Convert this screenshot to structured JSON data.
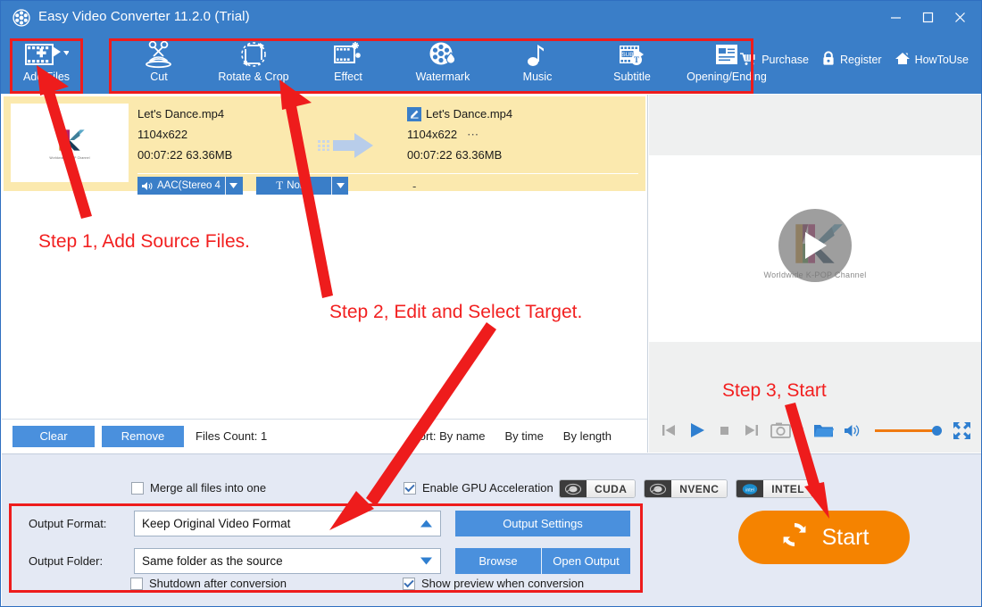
{
  "window": {
    "title": "Easy Video Converter 11.2.0 (Trial)",
    "app_icon": "film-reel-icon",
    "controls": {
      "minimize": "minimize-icon",
      "maximize": "maximize-icon",
      "close": "close-icon"
    }
  },
  "toolbar": {
    "add_files": {
      "label": "Add Files",
      "icon": "add-film-icon"
    },
    "items": [
      {
        "label": "Cut",
        "icon": "scissors-icon"
      },
      {
        "label": "Rotate & Crop",
        "icon": "rotate-crop-icon"
      },
      {
        "label": "Effect",
        "icon": "effect-film-icon"
      },
      {
        "label": "Watermark",
        "icon": "watermark-icon"
      },
      {
        "label": "Music",
        "icon": "music-note-icon"
      },
      {
        "label": "Subtitle",
        "icon": "subtitle-icon"
      },
      {
        "label": "Opening/Ending",
        "icon": "opening-ending-icon"
      }
    ],
    "links": [
      {
        "label": "Purchase",
        "icon": "cart-icon"
      },
      {
        "label": "Register",
        "icon": "lock-icon"
      },
      {
        "label": "HowToUse",
        "icon": "home-icon"
      }
    ]
  },
  "file_list": {
    "row": {
      "thumbnail_caption": "Worldwide K-POP Channel",
      "source": {
        "name": "Let's Dance.mp4",
        "resolution": "1104x622",
        "duration_size": "00:07:22  63.36MB"
      },
      "target": {
        "name": "Let's Dance.mp4",
        "resolution": "1104x622",
        "resolution_more": "⋯",
        "duration_size": "00:07:22  63.36MB",
        "edit_icon": "pencil-icon"
      },
      "audio_track": "AAC(Stereo 4",
      "subtitle_track": "None",
      "target_extra": "-"
    },
    "toolbar": {
      "clear": "Clear",
      "remove": "Remove",
      "files_count_label": "Files Count:",
      "files_count_value": "1",
      "sort_label": "Sort:",
      "sort_options": [
        "By name",
        "By time",
        "By length"
      ]
    }
  },
  "preview": {
    "caption": "Worldwide K-POP Channel",
    "controls": [
      {
        "name": "prev-icon"
      },
      {
        "name": "play-icon"
      },
      {
        "name": "stop-icon"
      },
      {
        "name": "next-icon"
      },
      {
        "name": "snapshot-icon"
      },
      {
        "name": "snapshot-dropdown-icon"
      },
      {
        "name": "folder-icon"
      },
      {
        "name": "volume-icon"
      },
      {
        "name": "volume-slider"
      },
      {
        "name": "fullscreen-icon"
      }
    ]
  },
  "options": {
    "merge_all": {
      "label": "Merge all files into one",
      "checked": false
    },
    "gpu": {
      "label": "Enable GPU Acceleration",
      "checked": true
    },
    "gpu_badges": [
      "CUDA",
      "NVENC",
      "INTEL"
    ],
    "output_format": {
      "label": "Output Format:",
      "value": "Keep Original Video Format",
      "caret": "up"
    },
    "output_folder": {
      "label": "Output Folder:",
      "value": "Same folder as the source",
      "caret": "down"
    },
    "output_settings_button": "Output Settings",
    "browse_button": "Browse",
    "open_output_button": "Open Output",
    "shutdown": {
      "label": "Shutdown after conversion",
      "checked": false
    },
    "show_preview": {
      "label": "Show preview when conversion",
      "checked": true
    }
  },
  "start_button": {
    "label": "Start",
    "icon": "refresh-icon",
    "color": "#f58300"
  },
  "annotations": {
    "color": "#f22020",
    "step1": "Step 1, Add Source Files.",
    "step2": "Step 2, Edit and Select Target.",
    "step3": "Step 3, Start"
  }
}
